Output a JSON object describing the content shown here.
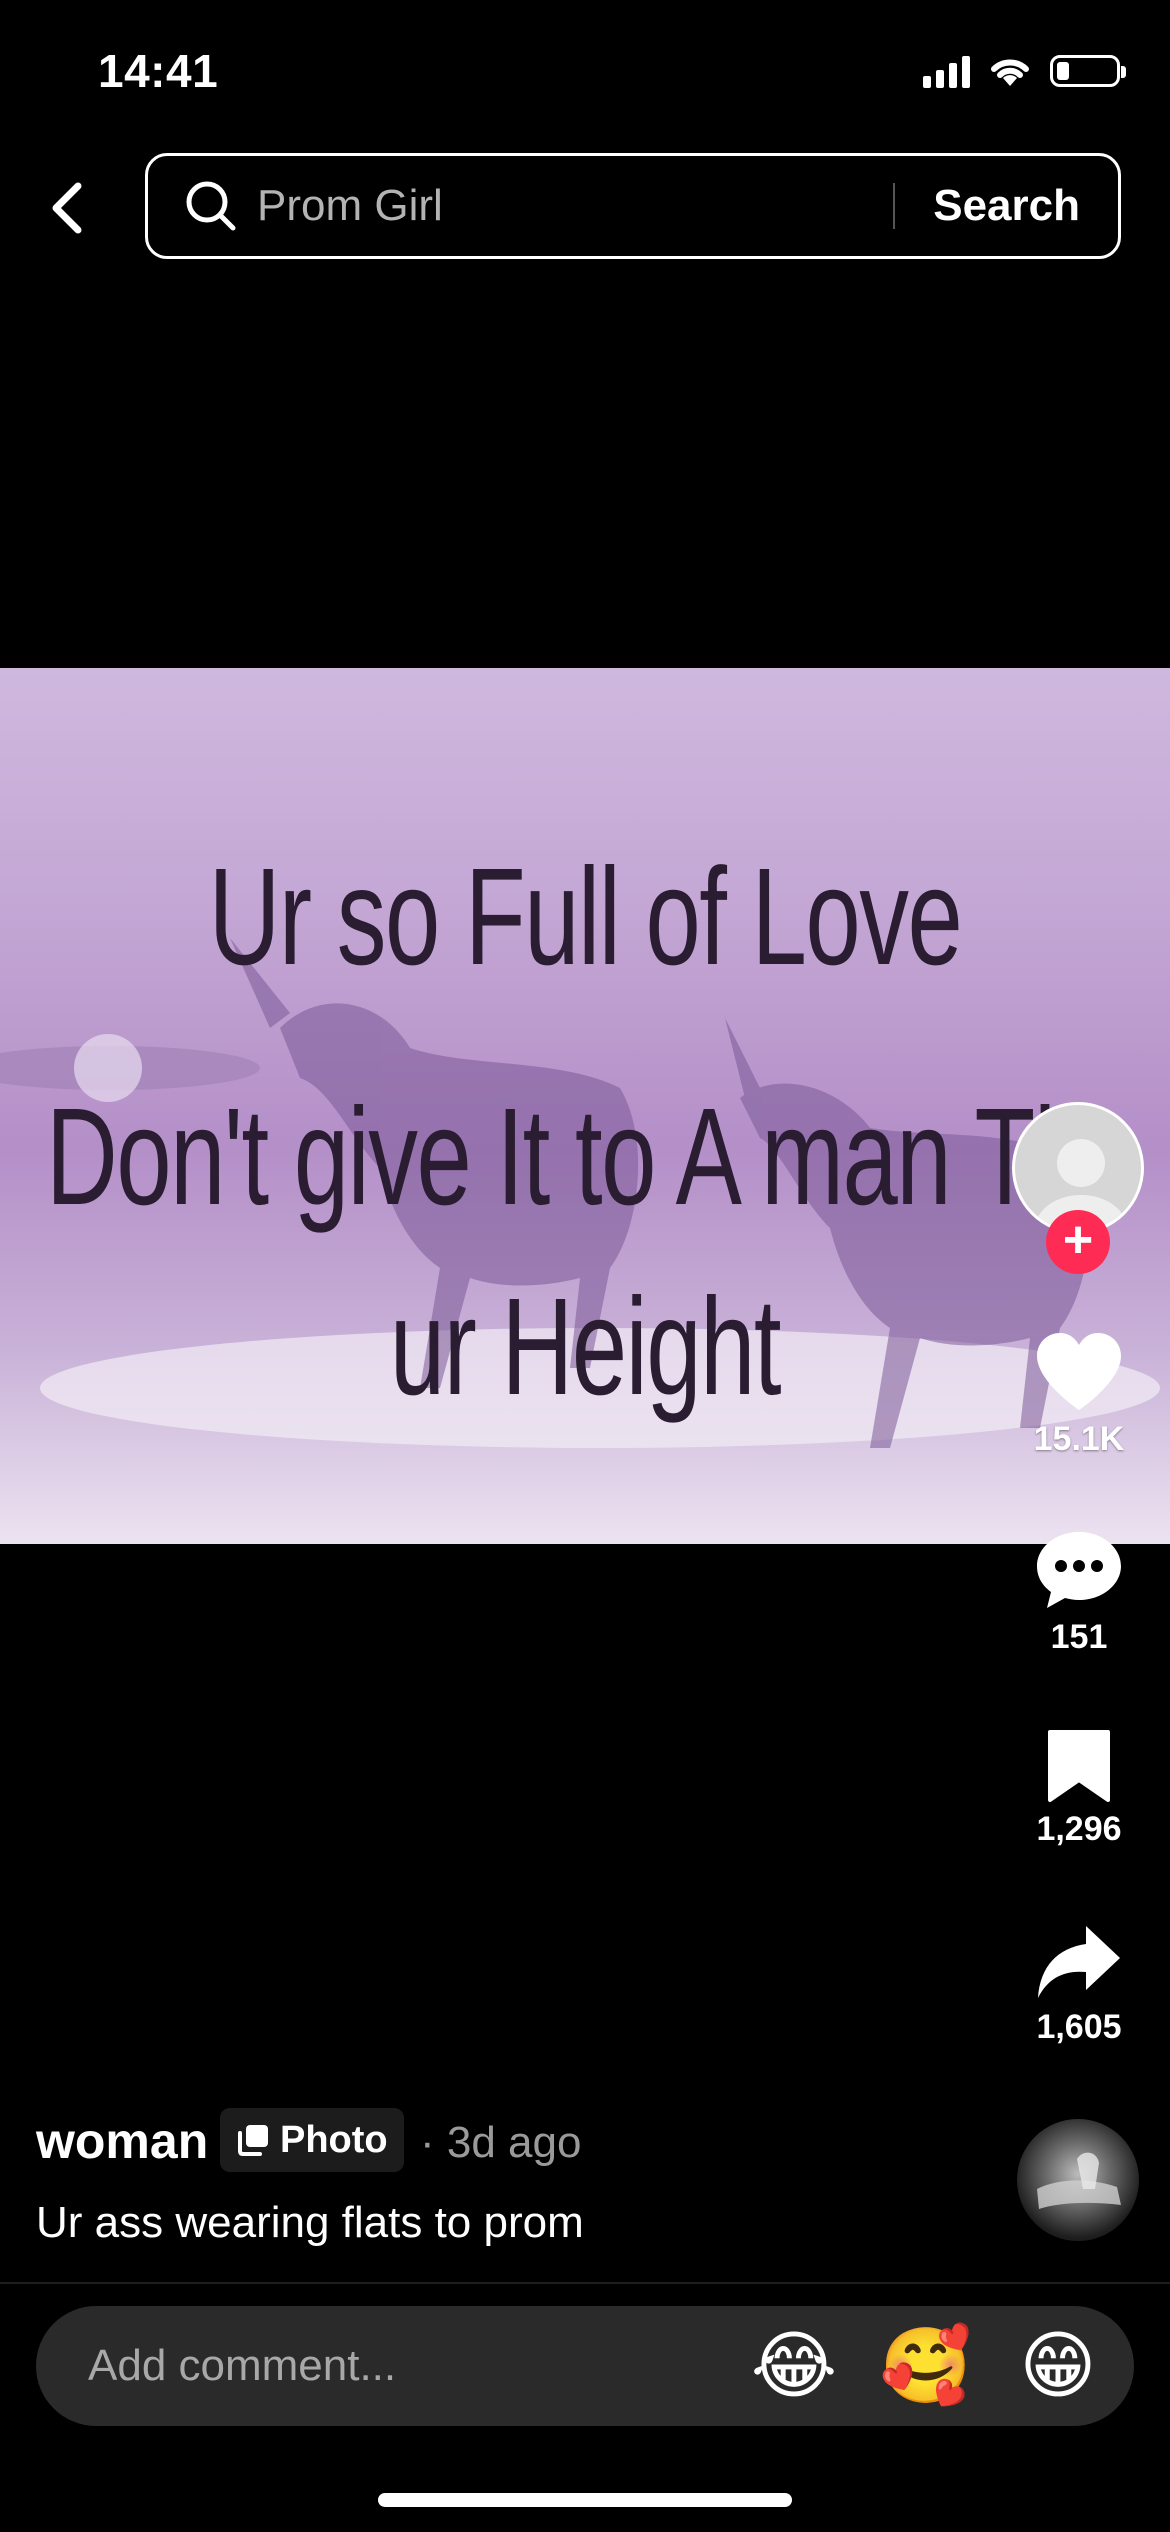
{
  "status_bar": {
    "time": "14:41"
  },
  "search": {
    "query": "Prom Girl",
    "button_label": "Search"
  },
  "post": {
    "image_text": [
      "Ur so Full of Love",
      "Don't give It to A man Th",
      "ur Height"
    ],
    "author": "woman",
    "badge_label": "Photo",
    "time": "· 3d ago",
    "description": "Ur ass wearing flats to prom"
  },
  "actions": {
    "likes": "15.1K",
    "comments": "151",
    "saves": "1,296",
    "shares": "1,605"
  },
  "comment_bar": {
    "placeholder": "Add comment...",
    "emojis": [
      "😂",
      "🥰",
      "😁"
    ]
  },
  "colors": {
    "accent": "#fe2c55",
    "background": "#000000"
  }
}
